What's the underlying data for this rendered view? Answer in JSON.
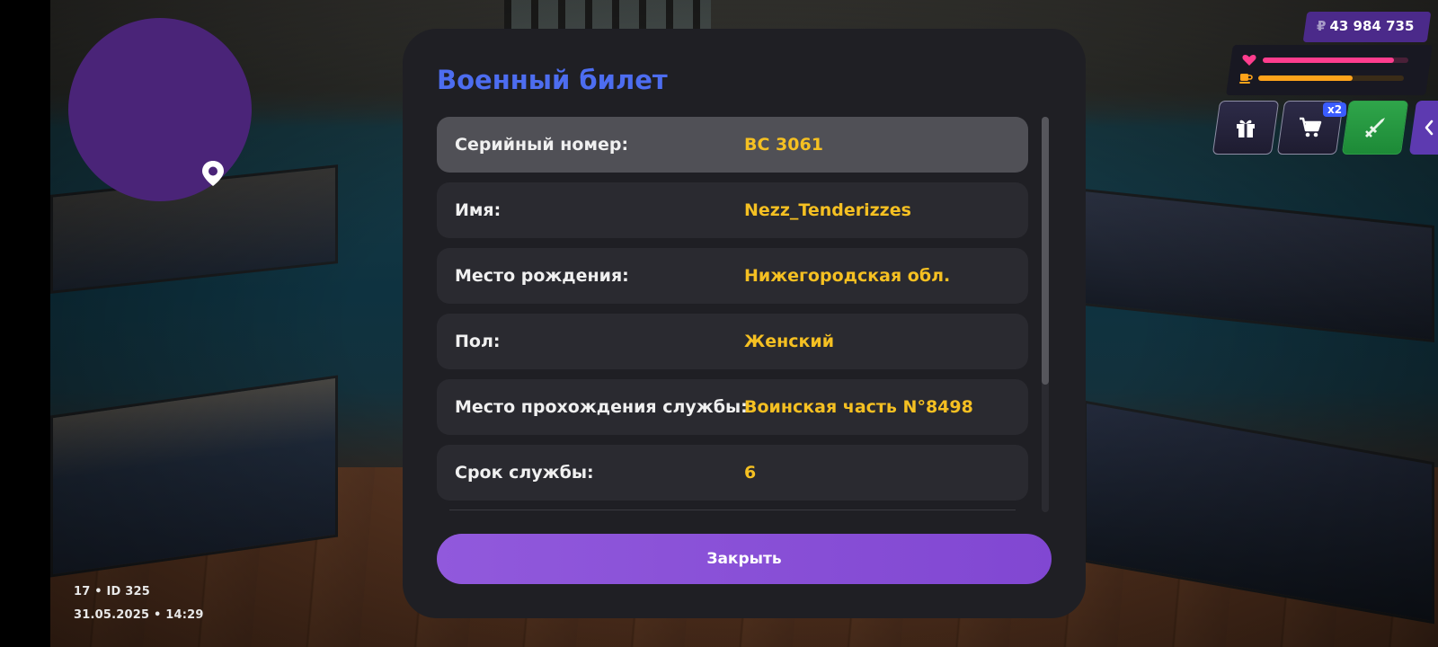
{
  "hud": {
    "money_symbol": "₽",
    "money": "43 984 735",
    "health_level": 0.9,
    "food_level": 0.65,
    "cart_badge": "x2",
    "colors": {
      "accent": "#4b2a8a",
      "health": "#ff3d8e",
      "food": "#ffa31a",
      "weapon": "#2fa54a"
    },
    "icons": [
      "heart-icon",
      "cup-icon",
      "gift-icon",
      "cart-icon",
      "weapon-icon",
      "chevron-left-icon",
      "map-pin-icon"
    ]
  },
  "status": {
    "line1": "17 • ID 325",
    "line2": "31.05.2025 • 14:29"
  },
  "modal": {
    "title": "Военный билет",
    "rows": [
      {
        "label": "Серийный номер:",
        "value": "BC 3061"
      },
      {
        "label": "Имя:",
        "value": "Nezz_Tenderizzes"
      },
      {
        "label": "Место рождения:",
        "value": "Нижегородская обл."
      },
      {
        "label": "Пол:",
        "value": "Женский"
      },
      {
        "label": "Место прохождения службы:",
        "value": "Воинская часть N°8498"
      },
      {
        "label": "Срок службы:",
        "value": "6"
      }
    ],
    "close_label": "Закрыть",
    "colors": {
      "title": "#4d6df0",
      "value": "#f5c022",
      "button": "#8f57db"
    }
  }
}
